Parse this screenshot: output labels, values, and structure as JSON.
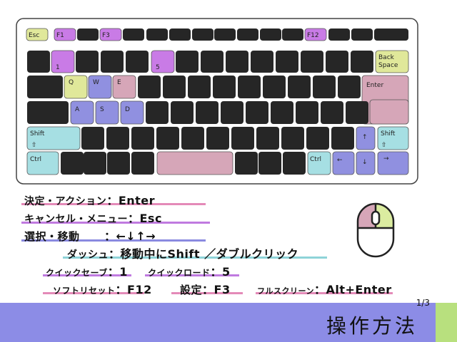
{
  "colors": {
    "key_dark": "#262626",
    "key_purple": "#c97be6",
    "key_lavender": "#9090e0",
    "key_yellow": "#e0e89a",
    "key_teal": "#a6dfe3",
    "key_pink": "#d6a6b8",
    "key_green": "#dbeca0",
    "footer": "#8c8ce6",
    "footer_accent": "#b8e07e",
    "ul_pink": "#e48ab8",
    "ul_purple": "#c07ae0",
    "ul_lavender": "#8a8ae0",
    "ul_teal": "#8ed3d8"
  },
  "keyboard": {
    "keys": {
      "esc": "Esc",
      "f1": "F1",
      "f3": "F3",
      "f12": "F12",
      "one": "1",
      "five": "5",
      "backspace_1": "Back",
      "backspace_2": "Space",
      "q": "Q",
      "w": "W",
      "e": "E",
      "enter": "Enter",
      "a": "A",
      "s": "S",
      "d": "D",
      "lshift": "Shift",
      "rshift": "Shift",
      "lctrl": "Ctrl",
      "rctrl": "Ctrl",
      "arrow_up": "↑",
      "arrow_down": "↓",
      "arrow_left": "←",
      "arrow_right": "→",
      "shift_glyph": "⇧"
    }
  },
  "controls": {
    "decide_label": "決定・アクション",
    "decide_value": "：Enter",
    "cancel_label": "キャンセル・メニュー",
    "cancel_value": "：Esc",
    "select_label": "選択・移動",
    "select_value": "：←↓↑→",
    "dash_label": "ダッシュ",
    "dash_value": "：移動中にShift ／ダブルクリック",
    "quicksave_label": "クイックセーブ",
    "quicksave_value": "：1",
    "quickload_label": "クイックロード",
    "quickload_value": "：5",
    "softreset_label": "ソフトリセット",
    "softreset_value": "：F12",
    "settings_label": "設定",
    "settings_value": "：F3",
    "fullscreen_label": "フルスクリーン",
    "fullscreen_value": "：Alt+Enter"
  },
  "footer": {
    "page_counter": "1/3",
    "title": "操作方法"
  }
}
